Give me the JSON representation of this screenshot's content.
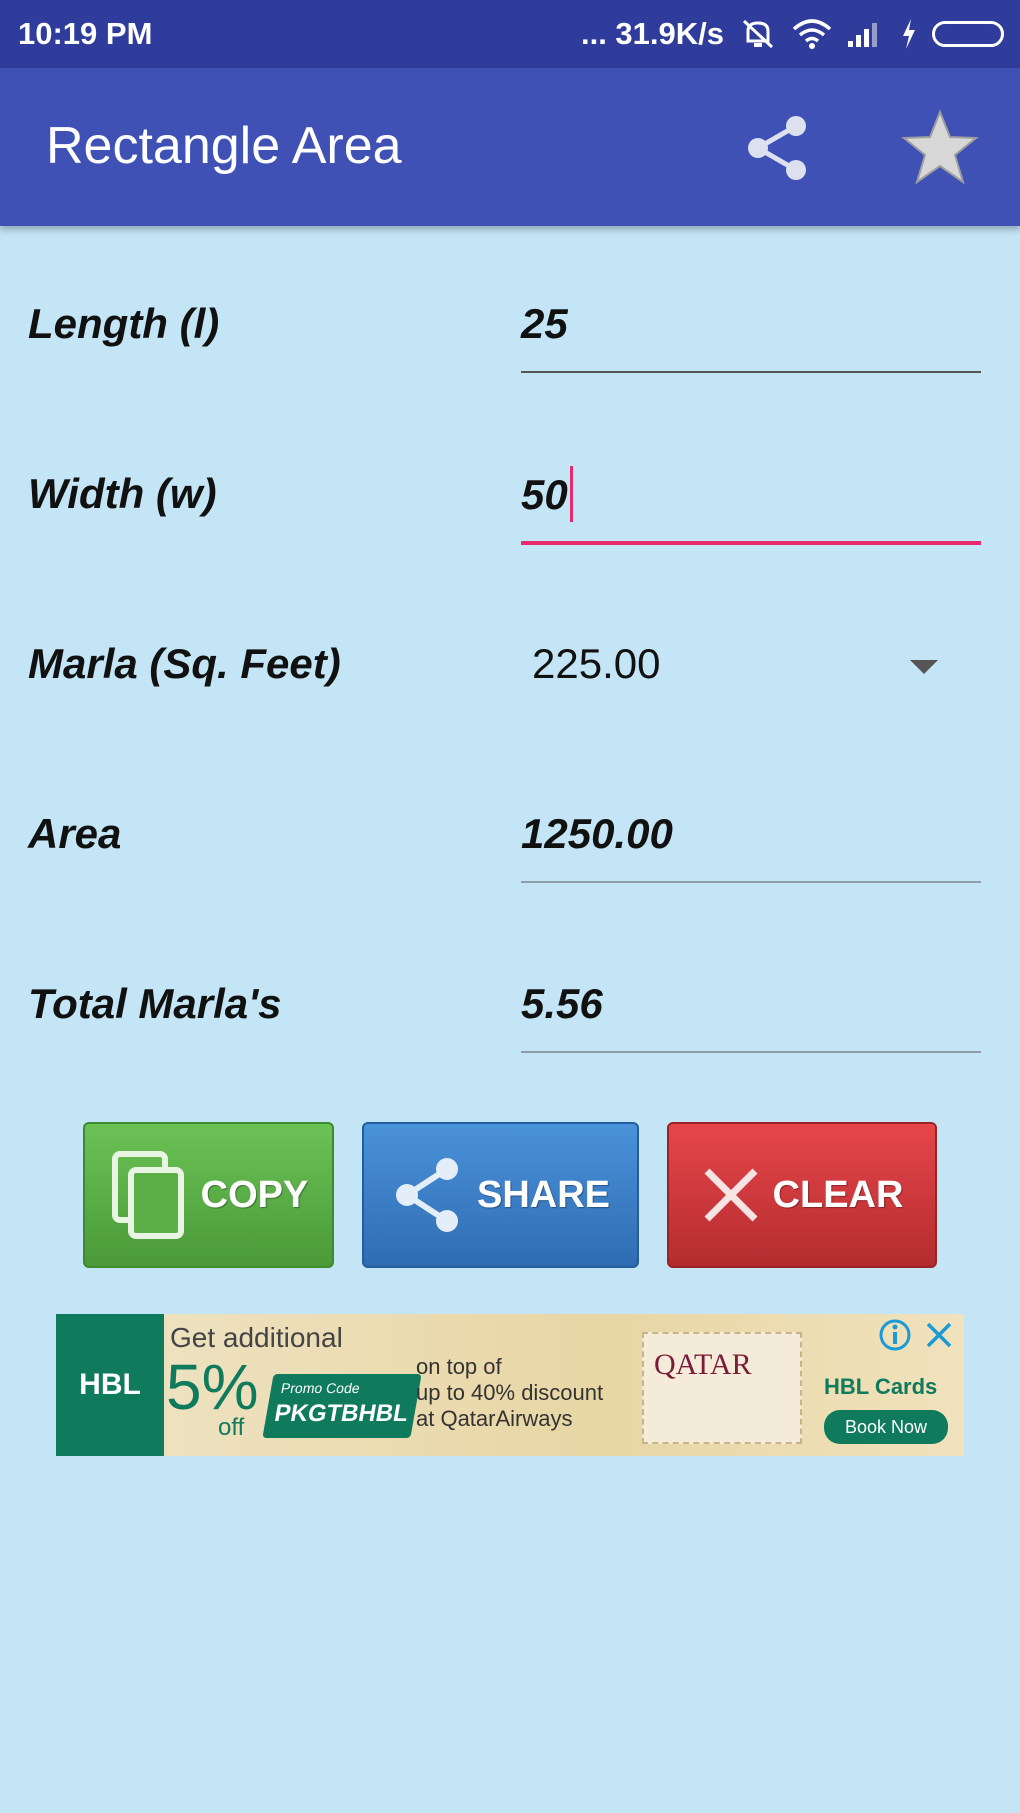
{
  "status_bar": {
    "time": "10:19 PM",
    "network_speed": "... 31.9K/s"
  },
  "app_bar": {
    "title": "Rectangle Area",
    "share_icon": "share-icon",
    "favorite_icon": "star-icon"
  },
  "form": {
    "length": {
      "label": "Length (l)",
      "value": "25"
    },
    "width": {
      "label": "Width (w)",
      "value": "50"
    },
    "marla": {
      "label": "Marla (Sq. Feet)",
      "value": "225.00"
    },
    "area": {
      "label": "Area",
      "value": "1250.00"
    },
    "total_marlas": {
      "label": "Total Marla's",
      "value": "5.56"
    }
  },
  "buttons": {
    "copy": {
      "label": "COPY",
      "color": "#5bb047"
    },
    "share": {
      "label": "SHARE",
      "color": "#3b7fc6"
    },
    "clear": {
      "label": "CLEAR",
      "color": "#d13a3d"
    }
  },
  "ad": {
    "brand": "HBL",
    "headline": "Get additional",
    "percent": "5%",
    "off": "off",
    "promo_small": "Promo Code",
    "promo_code": "PKGTBHBL",
    "line1": "on top of",
    "line2": "up to 40% discount",
    "line3": "at QatarAirways",
    "airline": "QATAR",
    "cards": "HBL Cards",
    "cta": "Book Now"
  },
  "colors": {
    "primary": "#3f51b5",
    "primary_dark": "#2f3c9c",
    "background": "#c3e5f5",
    "accent": "#ea2a6e"
  }
}
